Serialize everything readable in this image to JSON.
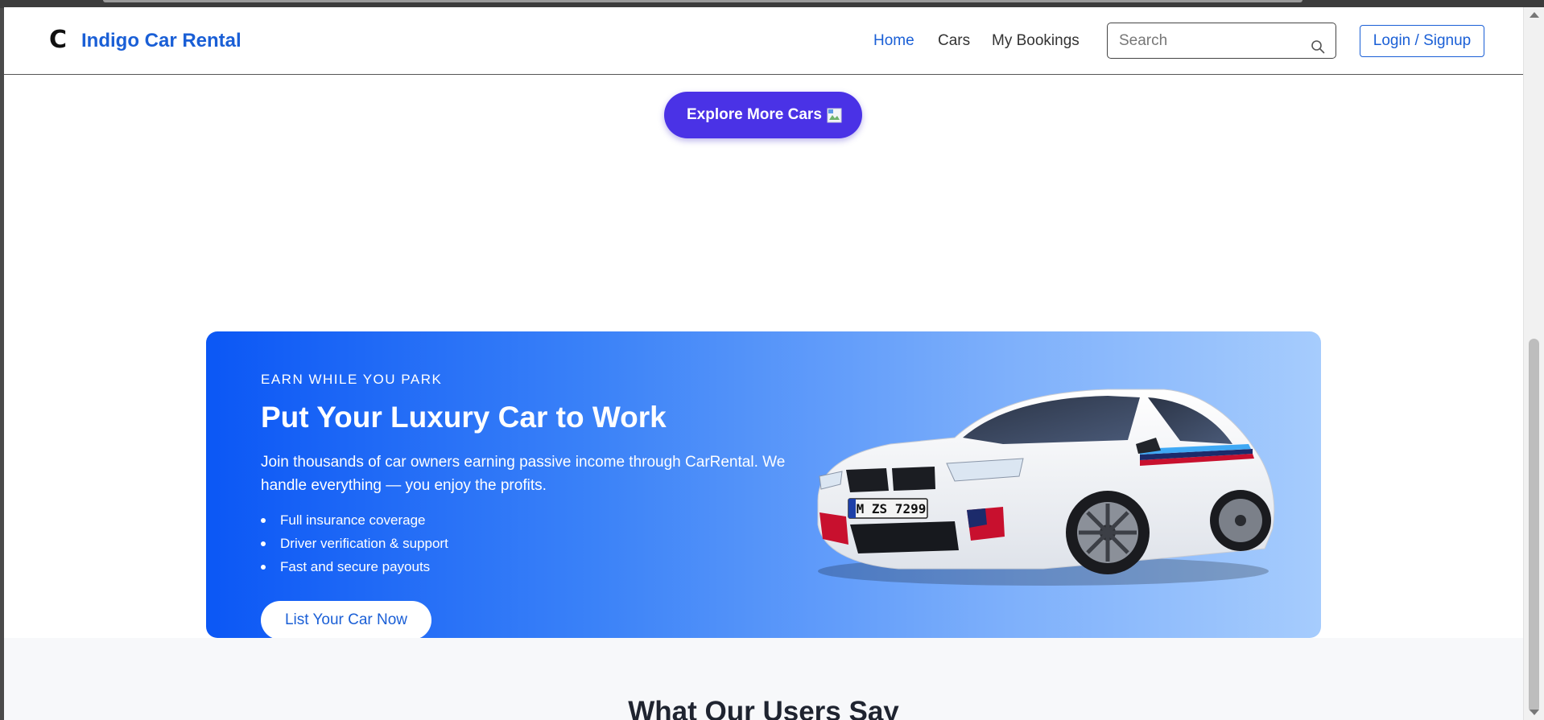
{
  "navbar": {
    "brand_mark": "C",
    "brand_name": "Indigo Car Rental",
    "links": [
      {
        "label": "Home",
        "active": true
      },
      {
        "label": "Cars",
        "active": false
      },
      {
        "label": "My Bookings",
        "active": false
      }
    ],
    "search": {
      "placeholder": "Search",
      "value": "",
      "icon": "search-icon"
    },
    "login_label": "Login / Signup"
  },
  "explore": {
    "label": "Explore More Cars",
    "icon": "broken-image-icon"
  },
  "promo": {
    "eyebrow": "EARN WHILE YOU PARK",
    "title": "Put Your Luxury Car to Work",
    "description": "Join thousands of car owners earning passive income through CarRental. We handle everything — you enjoy the profits.",
    "features": [
      "Full insurance coverage",
      "Driver verification & support",
      "Fast and secure payouts"
    ],
    "cta_label": "List Your Car Now",
    "car_plate": "M ZS 7299"
  },
  "testimonials": {
    "title": "What Our Users Say"
  },
  "colors": {
    "brand": "#1a5fd6",
    "explore_button": "#4a32e6",
    "banner_start": "#0b57f5",
    "banner_end": "#a6ccfd"
  }
}
